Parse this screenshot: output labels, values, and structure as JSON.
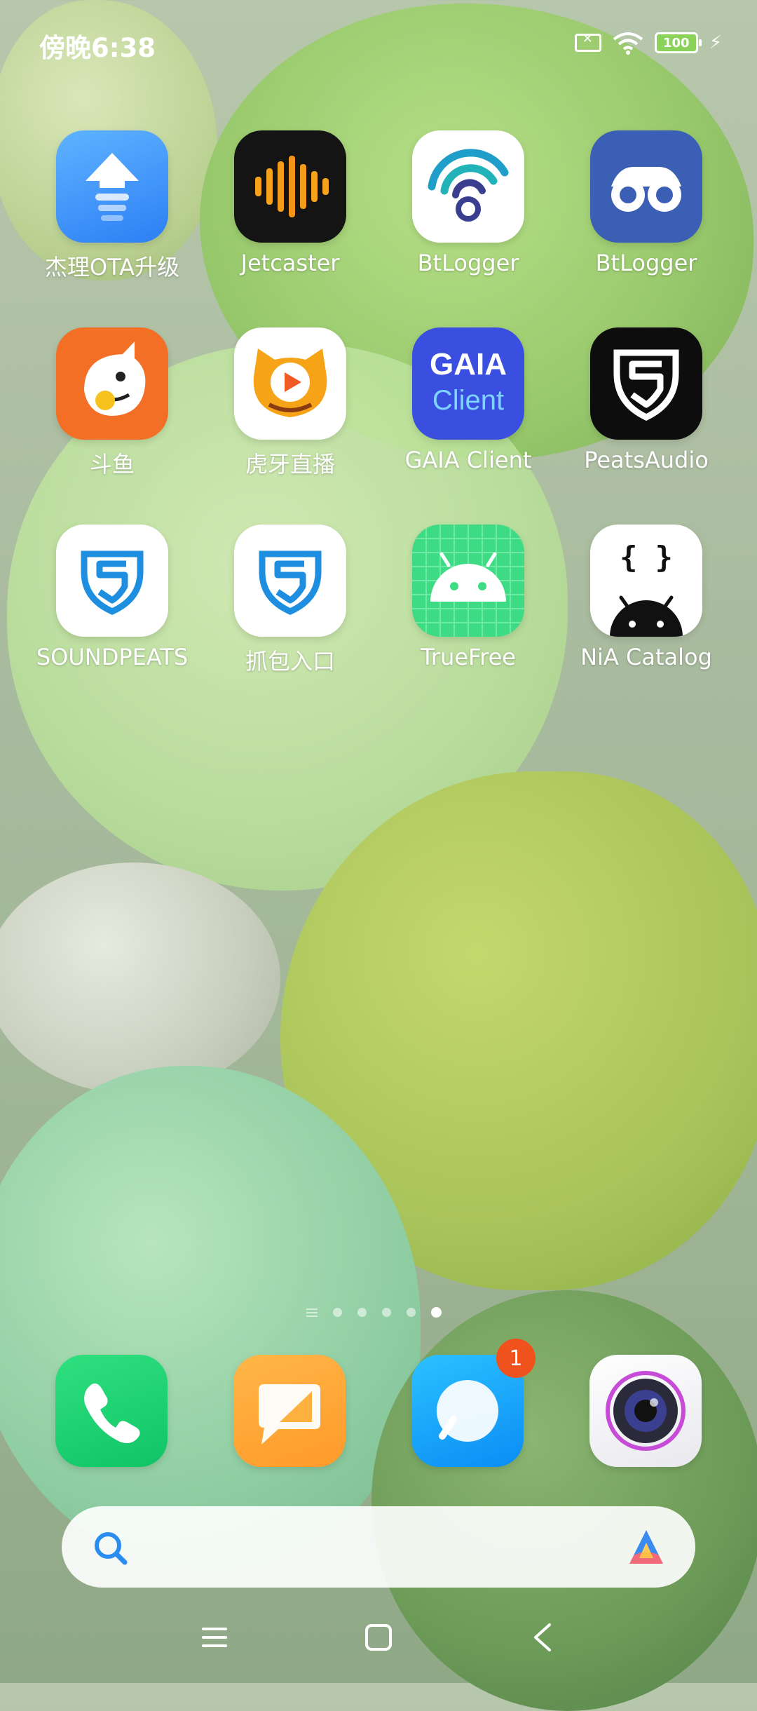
{
  "status_bar": {
    "time": "傍晚6:38",
    "battery_level": "100"
  },
  "apps": [
    {
      "label": "杰理OTA升级",
      "icon": "upload-arrow-icon"
    },
    {
      "label": "Jetcaster",
      "icon": "audio-bars-icon"
    },
    {
      "label": "BtLogger",
      "icon": "signal-keyhole-icon"
    },
    {
      "label": "BtLogger",
      "icon": "binoculars-icon"
    },
    {
      "label": "斗鱼",
      "icon": "shark-mascot-icon"
    },
    {
      "label": "虎牙直播",
      "icon": "tiger-play-icon"
    },
    {
      "label": "GAIA Client",
      "icon": "gaia-text-icon",
      "icon_text_1": "GAIA",
      "icon_text_2": "Client"
    },
    {
      "label": "PeatsAudio",
      "icon": "shield-s-icon"
    },
    {
      "label": "SOUNDPEATS",
      "icon": "shield-s-icon"
    },
    {
      "label": "抓包入口",
      "icon": "shield-s-icon"
    },
    {
      "label": "TrueFree",
      "icon": "android-icon"
    },
    {
      "label": "NiA Catalog",
      "icon": "android-braces-icon",
      "icon_text": "{ }"
    }
  ],
  "dock": [
    {
      "name": "phone",
      "icon": "phone-icon"
    },
    {
      "name": "messages",
      "icon": "message-icon"
    },
    {
      "name": "browser",
      "icon": "browser-icon",
      "badge": "1"
    },
    {
      "name": "camera",
      "icon": "camera-icon"
    }
  ],
  "page_indicator": {
    "pages": 5,
    "active": 5
  },
  "colors": {
    "accent": "#3a8bf0",
    "badge": "#f0521d"
  }
}
